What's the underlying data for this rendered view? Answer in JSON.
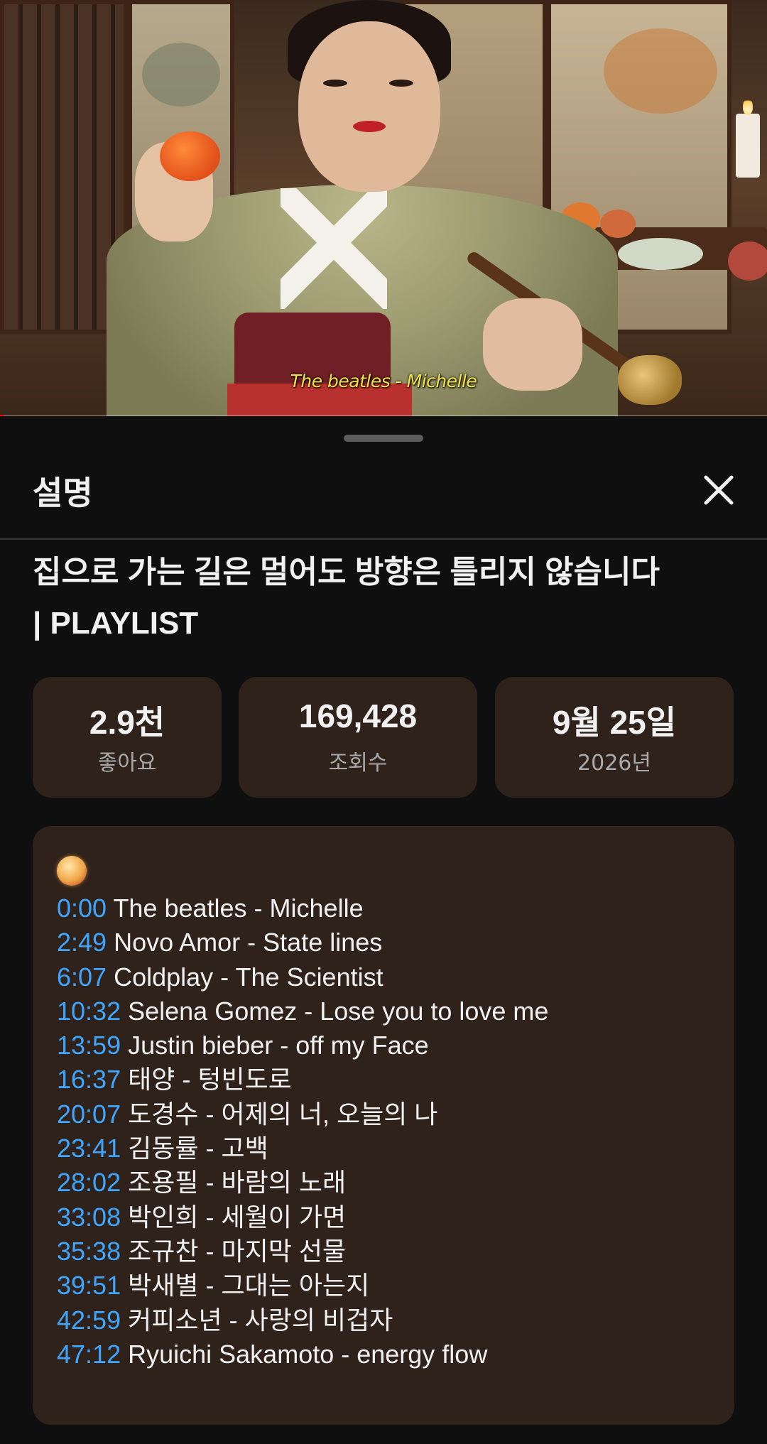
{
  "video": {
    "subtitle": "The beatles - Michelle",
    "progress": 0.005
  },
  "sheet": {
    "title": "설명",
    "close_icon": "close-icon",
    "video_title_line1": "집으로 가는 길은 멀어도 방향은 틀리지 않습니다",
    "video_title_line2": "| PLAYLIST",
    "stats": [
      {
        "value": "2.9천",
        "label": "좋아요"
      },
      {
        "value": "169,428",
        "label": "조회수"
      },
      {
        "value": "9월 25일",
        "label": "2026년"
      }
    ],
    "description": {
      "emoji": "full-moon-emoji",
      "tracks": [
        {
          "time": "0:00",
          "title": "The beatles - Michelle"
        },
        {
          "time": "2:49",
          "title": "Novo Amor - State lines"
        },
        {
          "time": "6:07",
          "title": "Coldplay - The Scientist"
        },
        {
          "time": "10:32",
          "title": "Selena Gomez - Lose you to love me"
        },
        {
          "time": "13:59",
          "title": "Justin bieber - off my Face"
        },
        {
          "time": "16:37",
          "title": "태양 - 텅빈도로"
        },
        {
          "time": "20:07",
          "title": "도경수 - 어제의 너, 오늘의 나"
        },
        {
          "time": "23:41",
          "title": "김동률 - 고백"
        },
        {
          "time": "28:02",
          "title": "조용필 - 바람의 노래"
        },
        {
          "time": "33:08",
          "title": "박인희 - 세월이 가면"
        },
        {
          "time": "35:38",
          "title": "조규찬 - 마지막 선물"
        },
        {
          "time": "39:51",
          "title": "박새별 - 그대는 아는지"
        },
        {
          "time": "42:59",
          "title": "커피소년 - 사랑의 비겁자"
        },
        {
          "time": "47:12",
          "title": "Ryuichi Sakamoto - energy flow"
        }
      ]
    }
  }
}
